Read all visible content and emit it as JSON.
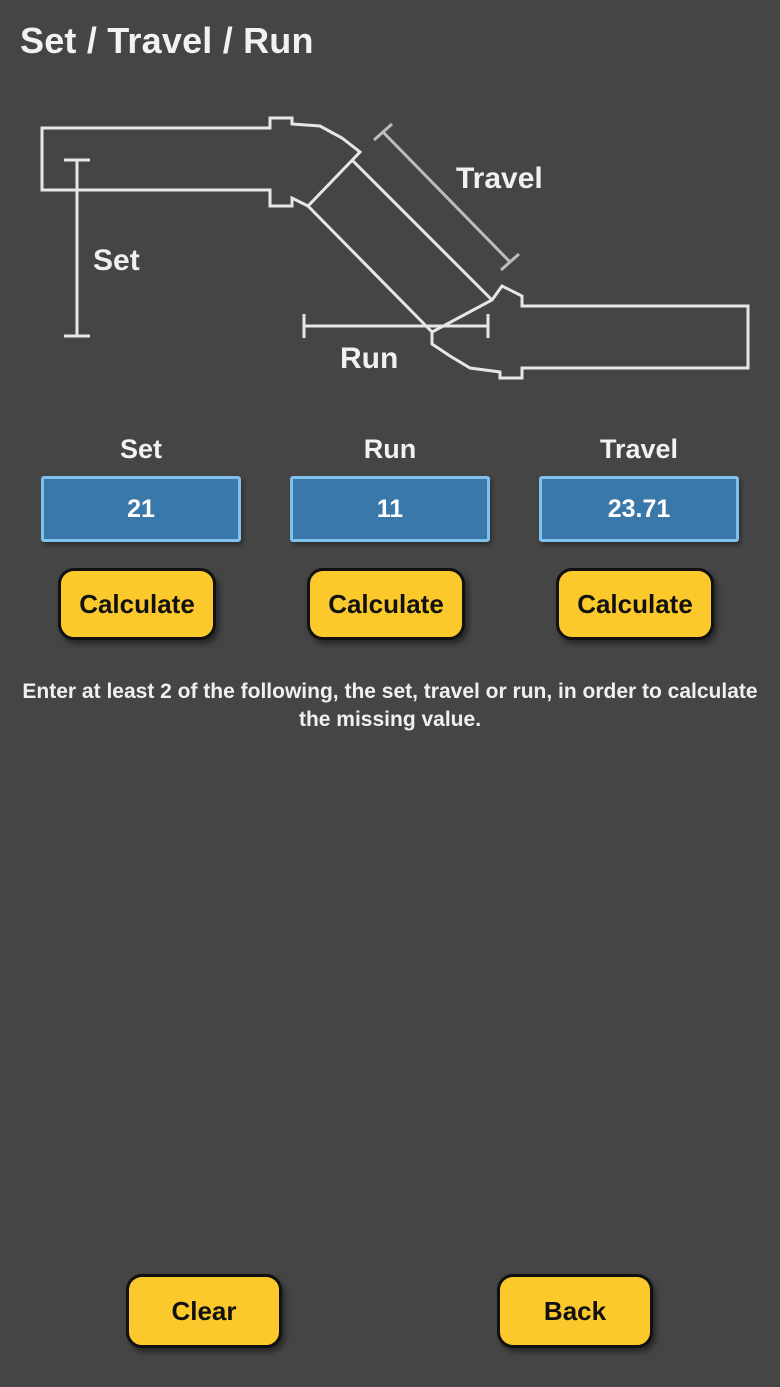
{
  "header": {
    "title": "Set / Travel / Run"
  },
  "diagram": {
    "set_label": "Set",
    "travel_label": "Travel",
    "run_label": "Run"
  },
  "fields": [
    {
      "label": "Set",
      "value": "21",
      "button_label": "Calculate"
    },
    {
      "label": "Run",
      "value": "11",
      "button_label": "Calculate"
    },
    {
      "label": "Travel",
      "value": "23.71",
      "button_label": "Calculate"
    }
  ],
  "hint": "Enter at least 2 of the following, the set, travel or run, in order to calculate the missing value.",
  "footer": {
    "clear_label": "Clear",
    "back_label": "Back"
  },
  "colors": {
    "background": "#454545",
    "field_fill": "#3a78aa",
    "field_border": "#7fc0ec",
    "button_fill": "#fcc92c"
  }
}
